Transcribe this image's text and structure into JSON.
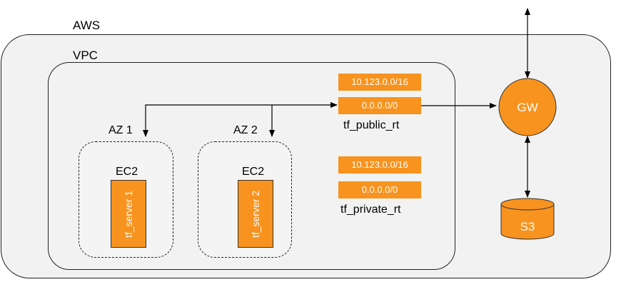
{
  "aws_label": "AWS",
  "vpc_label": "VPC",
  "az1": {
    "label": "AZ 1",
    "ec2_label": "EC2",
    "server": "tf_server 1"
  },
  "az2": {
    "label": "AZ 2",
    "ec2_label": "EC2",
    "server": "tf_server 2"
  },
  "public_rt": {
    "cidr": "10.123.0.0/16",
    "route": "0.0.0.0/0",
    "name": "tf_public_rt"
  },
  "private_rt": {
    "cidr": "10.123.0.0/16",
    "route": "0.0.0.0/0",
    "name": "tf_private_rt"
  },
  "gateway": {
    "label": "GW"
  },
  "s3": {
    "label": "S3"
  },
  "colors": {
    "accent": "#f7931e",
    "background": "#f2f2f2",
    "border": "#222222"
  }
}
